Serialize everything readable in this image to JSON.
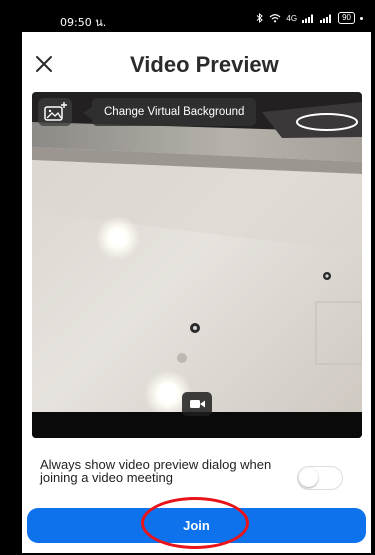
{
  "status_bar": {
    "time": "09:50 น.",
    "signal_label": "4G",
    "battery_label": "90"
  },
  "header": {
    "title": "Video Preview",
    "close_icon": "close-icon"
  },
  "preview": {
    "background_button_icon": "image-add-icon",
    "tooltip": "Change Virtual Background",
    "video_toggle_icon": "video-camera-icon"
  },
  "options": {
    "always_show_text": "Always show video preview dialog when joining a video meeting",
    "always_show_enabled": false
  },
  "actions": {
    "join_label": "Join"
  },
  "colors": {
    "accent": "#0e72ed",
    "annotation": "#e8141a",
    "title_text": "#2b2b2b"
  }
}
